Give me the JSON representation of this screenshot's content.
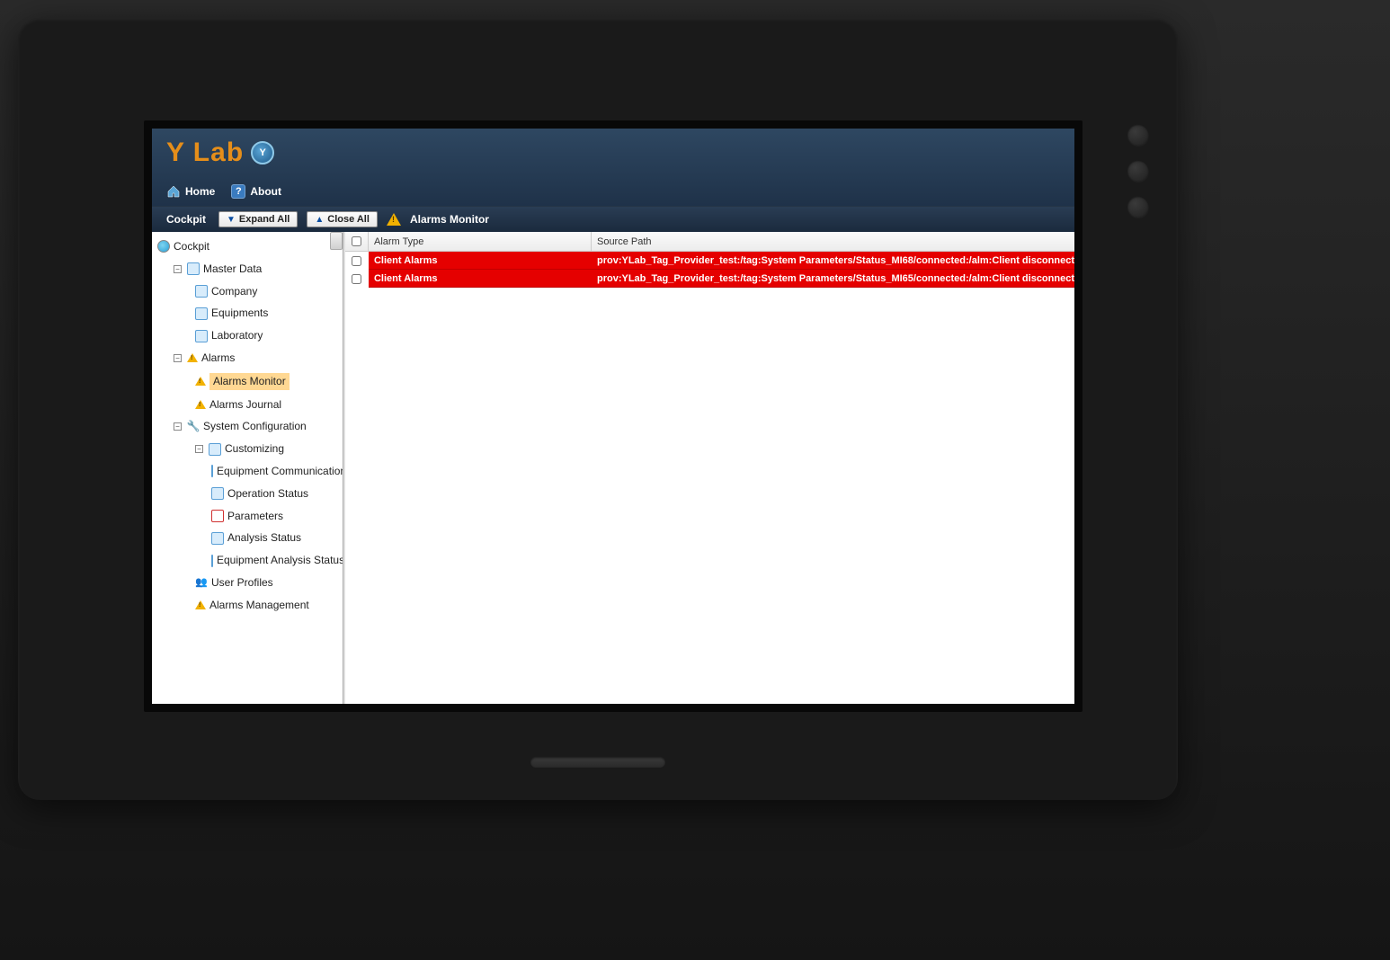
{
  "logo": {
    "text": "Y Lab",
    "badge": "Y"
  },
  "nav": {
    "home": "Home",
    "about": "About",
    "about_icon": "?"
  },
  "toolbar": {
    "label": "Cockpit",
    "expand": "Expand All",
    "close": "Close All",
    "breadcrumb": "Alarms Monitor"
  },
  "tree": {
    "root": "Cockpit",
    "master_data": "Master Data",
    "company": "Company",
    "equipments": "Equipments",
    "laboratory": "Laboratory",
    "alarms": "Alarms",
    "alarms_monitor": "Alarms Monitor",
    "alarms_journal": "Alarms Journal",
    "system_config": "System Configuration",
    "customizing": "Customizing",
    "equip_comm": "Equipment Communications",
    "op_status": "Operation Status",
    "parameters": "Parameters",
    "analysis_status": "Analysis Status",
    "equip_analysis": "Equipment Analysis Status",
    "user_profiles": "User Profiles",
    "alarms_mgmt": "Alarms Management"
  },
  "table": {
    "col1": "Alarm Type",
    "col2": "Source Path",
    "rows": [
      {
        "type": "Client Alarms",
        "path": "prov:YLab_Tag_Provider_test:/tag:System Parameters/Status_MI68/connected:/alm:Client disconnect"
      },
      {
        "type": "Client Alarms",
        "path": "prov:YLab_Tag_Provider_test:/tag:System Parameters/Status_MI65/connected:/alm:Client disconnect"
      }
    ]
  }
}
